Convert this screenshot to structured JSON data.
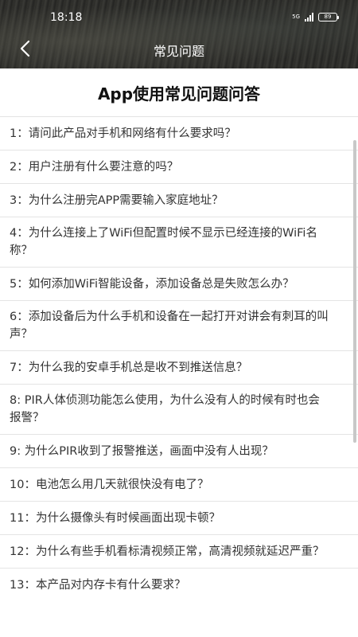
{
  "status_bar": {
    "time": "18:18",
    "network_label": "5G",
    "battery_level": "89"
  },
  "nav": {
    "title": "常见问题",
    "back_icon": "chevron-left-icon"
  },
  "page": {
    "heading": "App使用常见问题问答"
  },
  "faq": [
    "1：请问此产品对手机和网络有什么要求吗？",
    "2：用户注册有什么要注意的吗？",
    "3：为什么注册完APP需要输入家庭地址？",
    "4：为什么连接上了WiFi但配置时候不显示已经连接的WiFi名称？",
    "5：如何添加WiFi智能设备，添加设备总是失败怎么办？",
    "6：添加设备后为什么手机和设备在一起打开对讲会有刺耳的叫声？",
    "7：为什么我的安卓手机总是收不到推送信息？",
    "8: PIR人体侦测功能怎么使用，为什么没有人的时候有时也会报警？",
    "9: 为什么PIR收到了报警推送，画面中没有人出现？",
    "10：电池怎么用几天就很快没有电了？",
    "11：为什么摄像头有时候画面出现卡顿？",
    "12：为什么有些手机看标清视频正常，高清视频就延迟严重？",
    "13：本产品对内存卡有什么要求？"
  ]
}
